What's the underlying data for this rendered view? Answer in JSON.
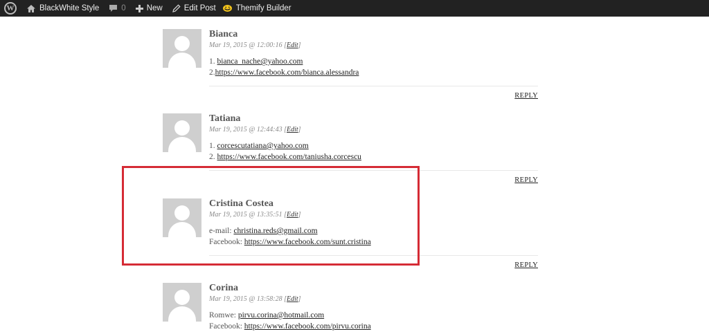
{
  "adminbar": {
    "site_name": "BlackWhite Style",
    "comments_count": "0",
    "new_label": "New",
    "edit_post_label": "Edit Post",
    "builder_label": "Themify Builder"
  },
  "comments": [
    {
      "author": "Bianca",
      "date": "Mar 19, 2015 @ 12:00:16",
      "edit_label": "Edit",
      "lines": [
        {
          "prefix": "1. ",
          "link": "bianca_nache@yahoo.com"
        },
        {
          "prefix": "2.",
          "link": "https://www.facebook.com/bianca.alessandra"
        }
      ],
      "reply_label": "REPLY"
    },
    {
      "author": "Tatiana",
      "date": "Mar 19, 2015 @ 12:44:43",
      "edit_label": "Edit",
      "lines": [
        {
          "prefix": "1. ",
          "link": "corcescutatiana@yahoo.com"
        },
        {
          "prefix": "2. ",
          "link": "https://www.facebook.com/taniusha.corcescu"
        }
      ],
      "reply_label": "REPLY"
    },
    {
      "author": "Cristina Costea",
      "date": "Mar 19, 2015 @ 13:35:51",
      "edit_label": "Edit",
      "lines": [
        {
          "prefix": "e-mail: ",
          "link": "christina.reds@gmail.com"
        },
        {
          "prefix": "Facebook: ",
          "link": "https://www.facebook.com/sunt.cristina"
        }
      ],
      "reply_label": "REPLY"
    },
    {
      "author": "Corina",
      "date": "Mar 19, 2015 @ 13:58:28",
      "edit_label": "Edit",
      "lines": [
        {
          "prefix": "Romwe: ",
          "link": "pirvu.corina@hotmail.com"
        },
        {
          "prefix": "Facebook: ",
          "link": "https://www.facebook.com/pirvu.corina"
        }
      ]
    }
  ],
  "colors": {
    "adminbar_bg": "#222222",
    "highlight": "#d52b35",
    "avatar_bg": "#cfcfcf"
  },
  "icons": {
    "wordpress": "wordpress-logo-icon",
    "home": "home-icon",
    "comments": "comment-bubble-icon",
    "new": "plus-icon",
    "edit": "pencil-icon",
    "builder": "themify-icon"
  }
}
